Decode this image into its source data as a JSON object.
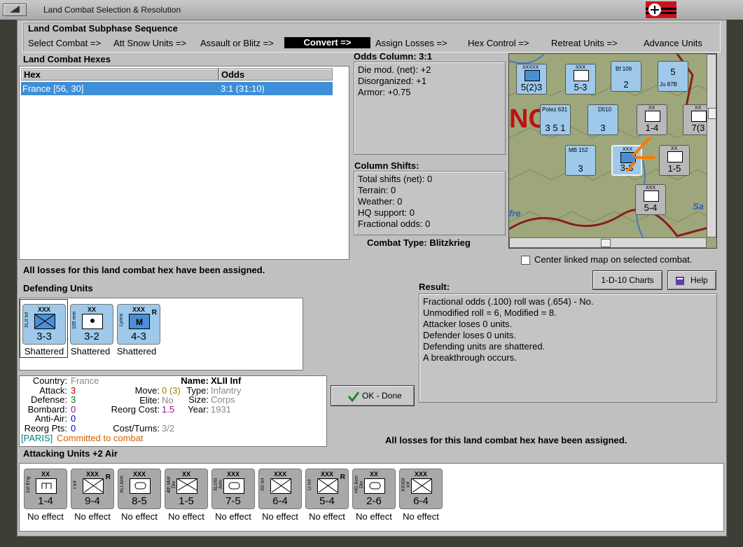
{
  "window": {
    "title": "Land Combat Selection & Resolution"
  },
  "sequence": {
    "title": "Land Combat Subphase Sequence",
    "steps": [
      "Select Combat =>",
      "Att Snow Units =>",
      "Assault or Blitz =>",
      "Convert =>",
      "Assign Losses =>",
      "Hex Control =>",
      "Retreat Units =>",
      "Advance Units"
    ]
  },
  "hexes": {
    "title": "Land Combat Hexes",
    "col_hex": "Hex",
    "col_odds": "Odds",
    "rows": [
      {
        "hex": "France [56, 30]",
        "odds": "3:1 (31:10)"
      }
    ]
  },
  "odds_column": {
    "title": "Odds Column: 3:1",
    "lines": [
      "Die mod. (net): +2",
      "Disorganized: +1",
      "Armor: +0.75"
    ]
  },
  "column_shifts": {
    "title": "Column Shifts:",
    "lines": [
      "Total shifts (net): 0",
      "Terrain: 0",
      "Weather: 0",
      "HQ support: 0",
      "Fractional odds: 0"
    ]
  },
  "combat_type": "Combat Type:  Blitzkrieg",
  "center_map": "Center linked map on selected combat.",
  "losses_msg": "All losses for this land combat hex have been assigned.",
  "defending": {
    "title": "Defending Units",
    "units": [
      {
        "size": "XXX",
        "name": "XLII Inf",
        "val": "3-3",
        "status": "Shattered",
        "r": ""
      },
      {
        "size": "XX",
        "name": "105 mm",
        "val": "3-2",
        "status": "Shattered",
        "r": ""
      },
      {
        "size": "XXX",
        "name": "Lyons",
        "val": "4-3",
        "status": "Shattered",
        "r": "R"
      }
    ]
  },
  "details": {
    "country_label": "Country:",
    "country": "France",
    "attack_label": "Attack:",
    "attack": "3",
    "defense_label": "Defense:",
    "defense": "3",
    "bombard_label": "Bombard:",
    "bombard": "0",
    "antiair_label": "Anti-Air:",
    "antiair": "0",
    "reorg_label": "Reorg Pts:",
    "reorg": "0",
    "move_label": "Move:",
    "move": "0 (3)",
    "elite_label": "Elite:",
    "elite": "No",
    "reorgcost_label": "Reorg Cost:",
    "reorgcost": "1.5",
    "costturns_label": "Cost/Turns:",
    "costturns": "3/2",
    "name_label": "Name:",
    "name": "XLII Inf",
    "type_label": "Type:",
    "type": "Infantry",
    "size_label": "Size:",
    "size": "Corps",
    "year_label": "Year:",
    "year": "1931",
    "location": "[PARIS]",
    "committed": "Committed to combat"
  },
  "buttons": {
    "charts": "1-D-10 Charts",
    "help": "Help",
    "ok": "OK - Done"
  },
  "result": {
    "title": "Result:",
    "lines": [
      "Fractional odds (.100) roll was (.654)  - No.",
      "Unmodified roll = 6, Modified = 8.",
      "Attacker loses 0 units.",
      "Defender loses 0 units.",
      "Defending units are shattered.",
      "A breakthrough occurs."
    ]
  },
  "attacking": {
    "title": "Attacking Units +2 Air",
    "units": [
      {
        "size": "XX",
        "name": "1st Eng",
        "val": "1-4",
        "status": "No effect",
        "r": ""
      },
      {
        "size": "XXX",
        "name": "I Inf",
        "val": "9-4",
        "status": "No effect",
        "r": "R"
      },
      {
        "size": "XXX",
        "name": "XLI Arm",
        "val": "8-5",
        "status": "No effect",
        "r": ""
      },
      {
        "size": "XX",
        "name": "4th Mot Div",
        "val": "1-5",
        "status": "No effect",
        "r": ""
      },
      {
        "size": "XXX",
        "name": "XLVIII Arm",
        "val": "7-5",
        "status": "No effect",
        "r": ""
      },
      {
        "size": "XXX",
        "name": "XII Inf",
        "val": "6-4",
        "status": "No effect",
        "r": ""
      },
      {
        "size": "XXX",
        "name": "LI Inf",
        "val": "5-4",
        "status": "No effect",
        "r": "R"
      },
      {
        "size": "XX",
        "name": "HG Arm Div",
        "val": "2-6",
        "status": "No effect",
        "r": ""
      },
      {
        "size": "XXX",
        "name": "XXXIII Inf",
        "val": "6-4",
        "status": "No effect",
        "r": ""
      }
    ]
  },
  "map": {
    "counters": [
      {
        "label": "XXXXX",
        "val": "5(2)3"
      },
      {
        "label": "XXX",
        "val": "5-3"
      },
      {
        "label": "Bf 109",
        "val": "2"
      },
      {
        "label": "Ju 87B",
        "val": "5"
      },
      {
        "label": "Potez 631",
        "val": "3 5 1"
      },
      {
        "label": "D510",
        "val": "3"
      },
      {
        "label": "XX",
        "val": "1-4"
      },
      {
        "label": "MB 152",
        "val": "3"
      },
      {
        "label": "XXX",
        "val": "3-3"
      },
      {
        "label": "XX",
        "val": "1-5"
      },
      {
        "label": "XXX",
        "val": "5-4"
      },
      {
        "label": "XX",
        "val": "7(3"
      }
    ],
    "labels": [
      "NC",
      "fre",
      "Sa"
    ]
  },
  "colors": {
    "selection": "#3e8ed8",
    "french_counter": "#9ec9ea",
    "german_counter": "#a8a8a8",
    "attack": "#c00000",
    "defense": "#008000",
    "bombard": "#a000a0"
  }
}
